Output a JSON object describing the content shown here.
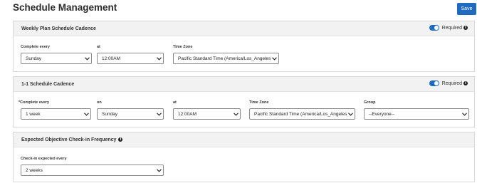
{
  "header": {
    "title": "Schedule Management",
    "save_label": "Save"
  },
  "weekly": {
    "title": "Weekly Plan Schedule Cadence",
    "required_label": "Required",
    "complete_every_label": "Complete every",
    "complete_every_value": "Sunday",
    "at_label": "at",
    "at_value": "12:00AM",
    "timezone_label": "Time Zone",
    "timezone_value": "Pacific Standard Time (America/Los_Angeles)"
  },
  "one_on_one": {
    "title": "1-1 Schedule Cadence",
    "required_label": "Required",
    "complete_every_label": "*Complete every",
    "complete_every_value": "1 week",
    "on_label": "on",
    "on_value": "Sunday",
    "at_label": "at",
    "at_value": "12:00AM",
    "timezone_label": "Time Zone",
    "timezone_value": "Pacific Standard Time (America/Los_Angeles)",
    "group_label": "Group",
    "group_value": "--Everyone--"
  },
  "objective": {
    "title": "Expected Objective Check-in Frequency",
    "checkin_label": "Check-in expected every",
    "checkin_value": "2 weeks"
  }
}
